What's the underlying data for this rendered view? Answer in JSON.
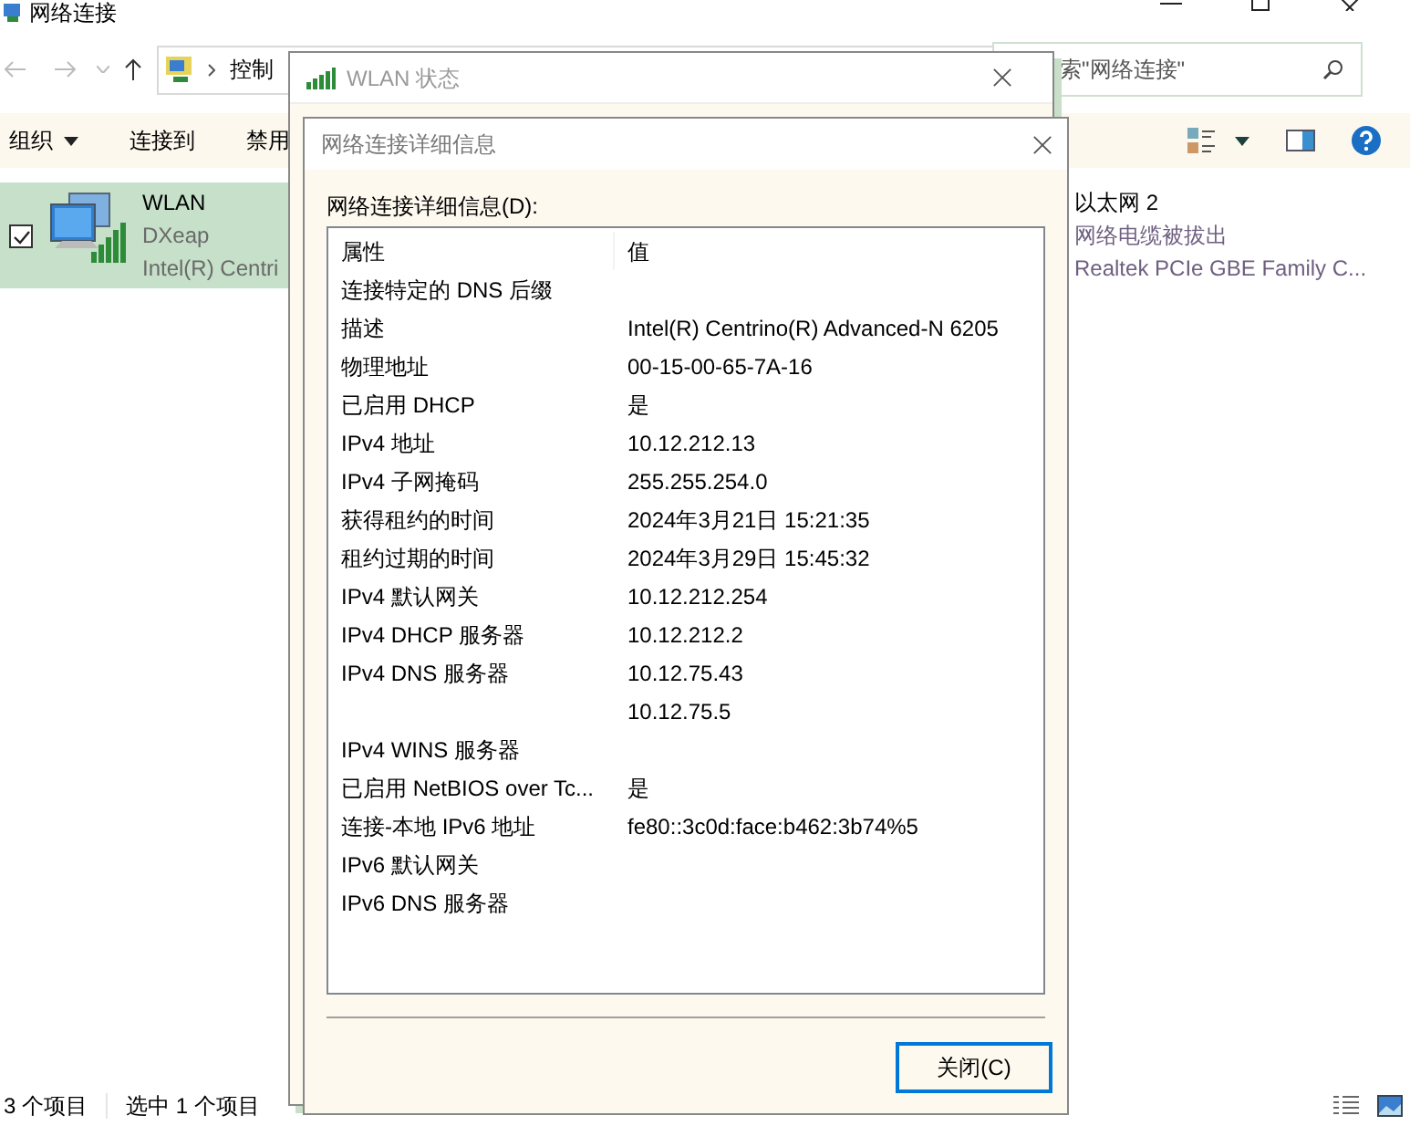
{
  "window": {
    "title": "网络连接"
  },
  "address": {
    "path": "控制"
  },
  "search": {
    "placeholder": "索\"网络连接\""
  },
  "toolbar": [
    {
      "label": "组织",
      "kind": "menu"
    },
    {
      "label": "连接到",
      "kind": "command"
    },
    {
      "label": "禁用",
      "kind": "command"
    }
  ],
  "connections": [
    {
      "name": "WLAN",
      "status": "DXeap",
      "device": "Intel(R) Centri",
      "selected": true,
      "kind": "wireless"
    },
    {
      "name": "以太网 2",
      "status": "网络电缆被拔出",
      "device": "Realtek PCIe GBE Family C...",
      "selected": false,
      "kind": "hidden"
    }
  ],
  "status_bar": {
    "item_count": "3 个项目",
    "selection": "选中 1 个项目"
  },
  "status_dialog": {
    "title": "WLAN 状态"
  },
  "details_dialog": {
    "title": "网络连接详细信息",
    "label": "网络连接详细信息(D):",
    "columns": [
      "属性",
      "值"
    ],
    "rows": [
      {
        "property": "连接特定的 DNS 后缀"
      },
      {
        "property": "描述",
        "value": "Intel(R) Centrino(R) Advanced-N 6205"
      },
      {
        "property": "物理地址",
        "value": "00-15-00-65-7A-16"
      },
      {
        "property": "已启用 DHCP",
        "value": "是"
      },
      {
        "property": "IPv4 地址",
        "value": "10.12.212.13"
      },
      {
        "property": "IPv4 子网掩码",
        "value": "255.255.254.0"
      },
      {
        "property": "获得租约的时间",
        "value": "2024年3月21日 15:21:35"
      },
      {
        "property": "租约过期的时间",
        "value": "2024年3月29日 15:45:32"
      },
      {
        "property": "IPv4 默认网关",
        "value": "10.12.212.254"
      },
      {
        "property": "IPv4 DHCP 服务器",
        "value": "10.12.212.2"
      },
      {
        "property": "IPv4 DNS 服务器",
        "value": "10.12.75.43"
      },
      {
        "value": "10.12.75.5"
      },
      {
        "property": "IPv4 WINS 服务器"
      },
      {
        "property": "已启用 NetBIOS over Tc...",
        "value": "是"
      },
      {
        "property": "连接-本地 IPv6 地址",
        "value": "fe80::3c0d:face:b462:3b74%5"
      },
      {
        "property": "IPv6 默认网关"
      },
      {
        "property": "IPv6 DNS 服务器"
      }
    ],
    "close_button": "关闭(C)"
  }
}
